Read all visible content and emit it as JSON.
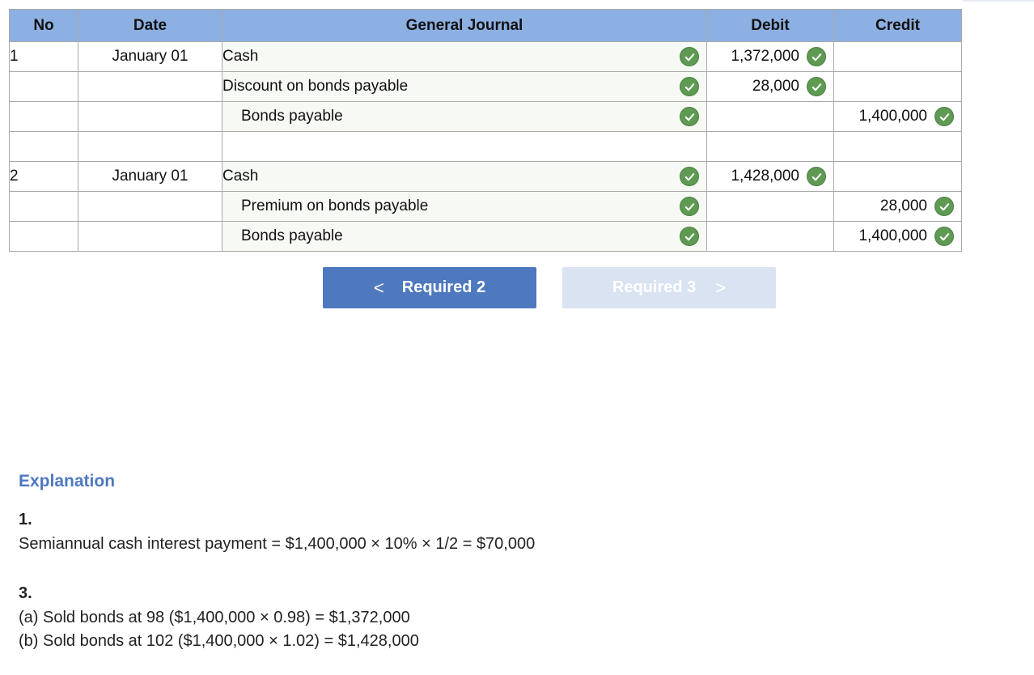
{
  "table": {
    "headers": {
      "no": "No",
      "date": "Date",
      "journal": "General Journal",
      "debit": "Debit",
      "credit": "Credit"
    },
    "rows": [
      {
        "no": "1",
        "date": "January 01",
        "account": "Cash",
        "debit": "1,372,000",
        "credit": ""
      },
      {
        "no": "",
        "date": "",
        "account": "Discount on bonds payable",
        "debit": "28,000",
        "credit": ""
      },
      {
        "no": "",
        "date": "",
        "account": "Bonds payable",
        "debit": "",
        "credit": "1,400,000"
      },
      {
        "no": "",
        "date": "",
        "account": "",
        "debit": "",
        "credit": ""
      },
      {
        "no": "2",
        "date": "January 01",
        "account": "Cash",
        "debit": "1,428,000",
        "credit": ""
      },
      {
        "no": "",
        "date": "",
        "account": "Premium on bonds payable",
        "debit": "",
        "credit": "28,000"
      },
      {
        "no": "",
        "date": "",
        "account": "Bonds payable",
        "debit": "",
        "credit": "1,400,000"
      }
    ]
  },
  "nav": {
    "prev_label": "Required 2",
    "next_label": "Required 3",
    "prev_chevron": "<",
    "next_chevron": ">"
  },
  "explanation": {
    "title": "Explanation",
    "item1_number": "1.",
    "item1_text": "Semiannual cash interest payment = $1,400,000 × 10% × 1/2 = $70,000",
    "item3_number": "3.",
    "item3_line_a": "(a) Sold bonds at 98 ($1,400,000 × 0.98) = $1,372,000",
    "item3_line_b": "(b) Sold bonds at 102 ($1,400,000 × 1.02) = $1,428,000"
  },
  "colors": {
    "header_bg": "#8db0e2",
    "check_green": "#5f9a53",
    "button_active": "#4e79bf",
    "button_disabled": "#d9e3f1"
  },
  "icons": {
    "correct": "check-circle-icon"
  }
}
